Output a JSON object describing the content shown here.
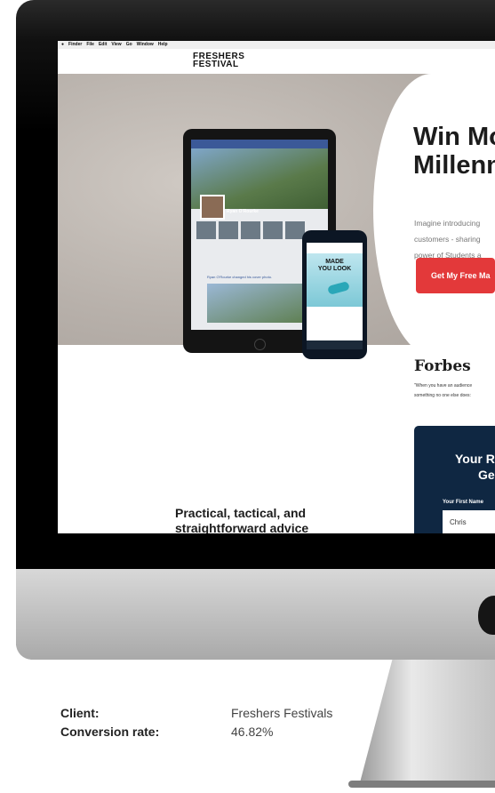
{
  "menubar": {
    "items": [
      "Finder",
      "File",
      "Edit",
      "View",
      "Go",
      "Window",
      "Help"
    ]
  },
  "site": {
    "logo_line1": "FRESHERS",
    "logo_line2": "FESTIVAL",
    "headline_line1": "Win Mo",
    "headline_line2": "Millenn",
    "copy_line1": "Imagine introducing",
    "copy_line2": "customers - sharing",
    "copy_line3": "power of Students a",
    "cta_label": "Get My Free Ma",
    "press_logo": "Forbes",
    "press_quote_line1": "\"When you have an audience",
    "press_quote_line2": "something no one else does:",
    "form_title_line1": "Your R",
    "form_title_line2": "Ge",
    "form_label": "Your First Name",
    "form_value": "Chris",
    "advice_line1": "Practical, tactical, and",
    "advice_line2": "straightforward advice"
  },
  "mockups": {
    "fb_profile_name": "Ryan O'Rourke",
    "fb_post_text": "Ryan O'Rourke changed his cover photo.",
    "ad_text_line1": "MADE",
    "ad_text_line2": "YOU LOOK"
  },
  "caption": {
    "client_label": "Client:",
    "client_value": "Freshers Festivals",
    "rate_label": "Conversion rate:",
    "rate_value": "46.82%"
  },
  "colors": {
    "cta": "#e3393a",
    "form_panel": "#0f2742",
    "facebook_blue": "#3b5998"
  }
}
